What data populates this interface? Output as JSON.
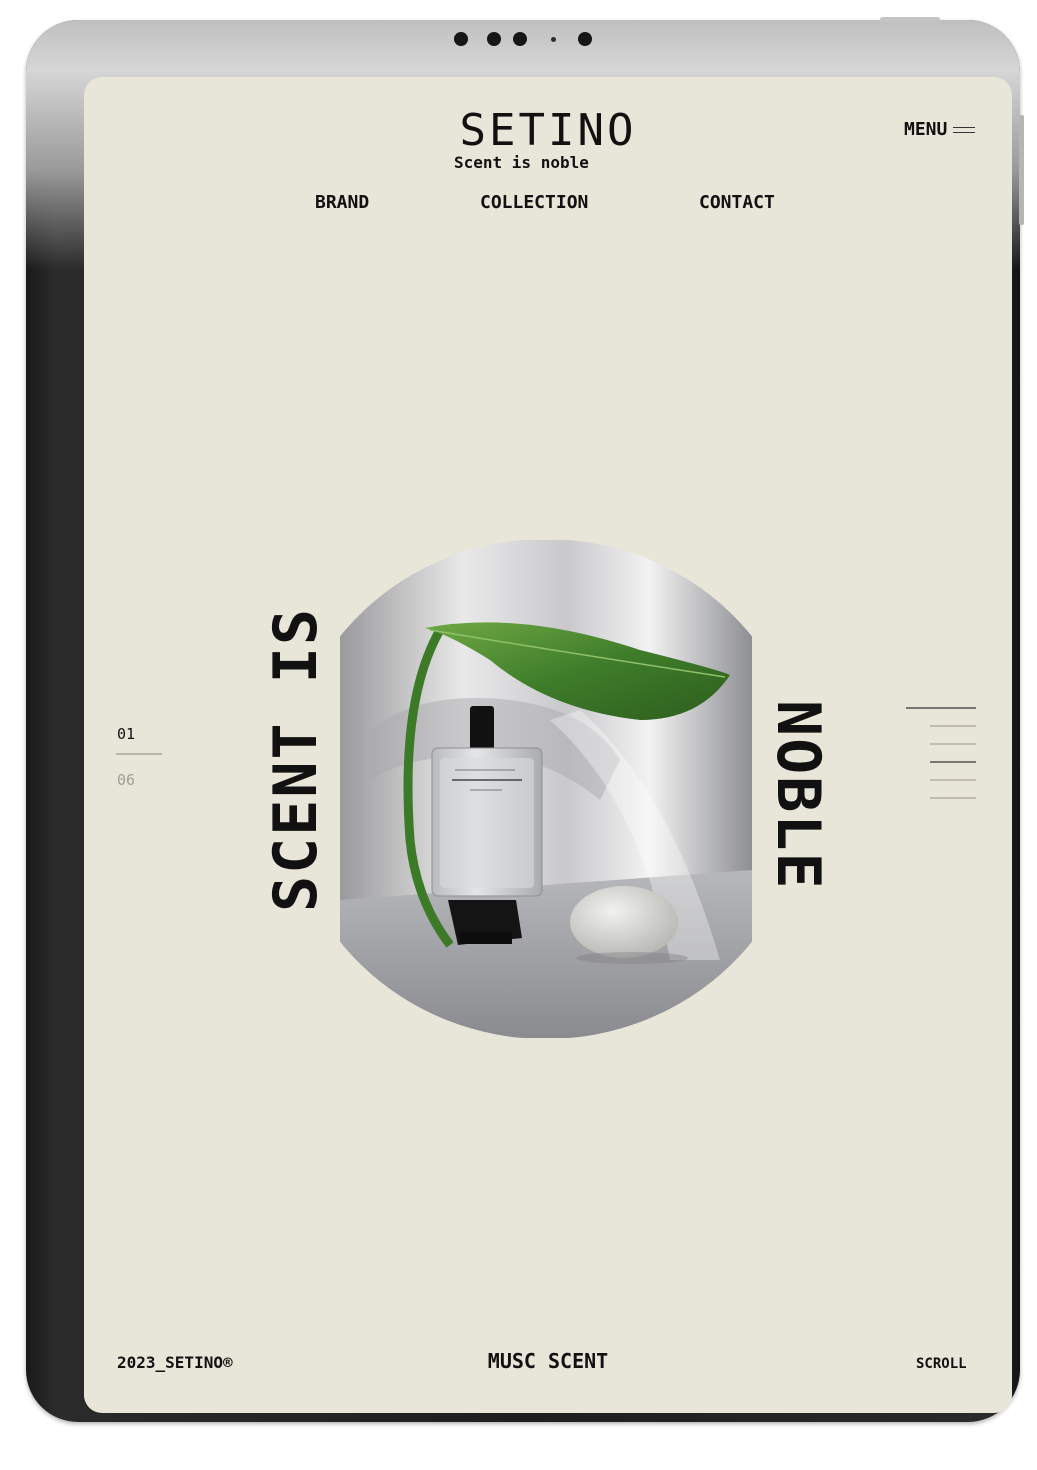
{
  "header": {
    "logo": "SETINO",
    "tagline": "Scent is noble",
    "menu_label": "MENU"
  },
  "nav": {
    "items": [
      "BRAND",
      "COLLECTION",
      "CONTACT"
    ]
  },
  "hero": {
    "left_text": "SCENT IS",
    "right_text": "NOBLE",
    "slide_current": "01",
    "slide_total": "06"
  },
  "footer": {
    "copyright": "2023_SETINO®",
    "product": "MUSC SCENT",
    "scroll_label": "SCROLL"
  },
  "colors": {
    "background": "#e8e5d9",
    "text": "#111111",
    "muted": "#a19e94"
  }
}
